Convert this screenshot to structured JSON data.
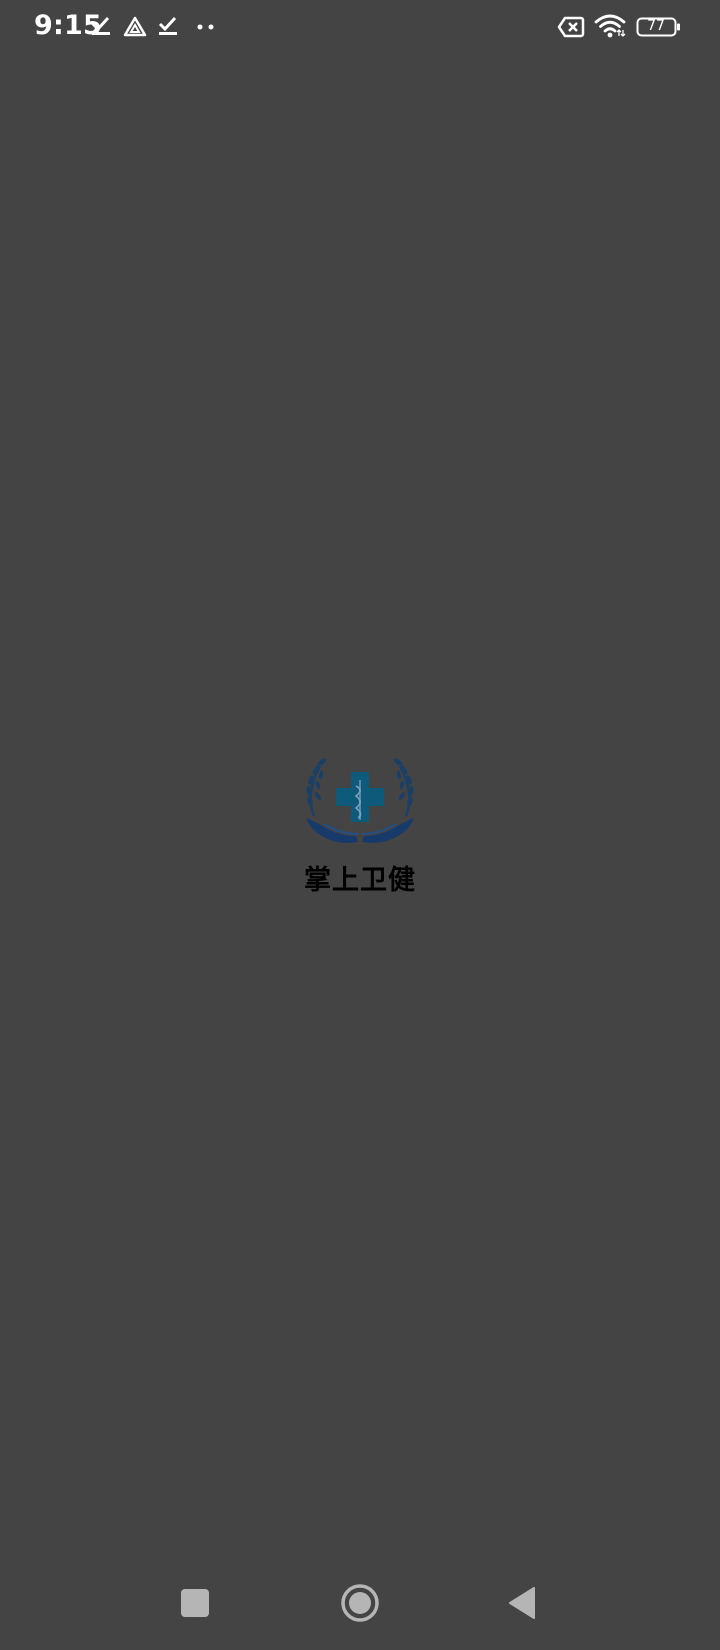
{
  "status_bar": {
    "time": "9:15",
    "battery_level": "77",
    "icons": [
      "checkmark-download-icon",
      "triangle-warning-icon",
      "checkmark-download-icon",
      "more-dots-icon",
      "no-sim-icon",
      "wifi-icon",
      "battery-icon"
    ]
  },
  "splash": {
    "app_name": "掌上卫健",
    "logo": "medical-cross-hands-logo"
  },
  "nav_bar": {
    "buttons": [
      "recents-button",
      "home-button",
      "back-button"
    ]
  },
  "colors": {
    "background": "#444444",
    "logo_primary": "#1c3f66",
    "logo_cross": "#0e5a7a",
    "text_dark": "#000000",
    "status_text": "#ffffff",
    "nav_icon": "#b5b5b5"
  }
}
